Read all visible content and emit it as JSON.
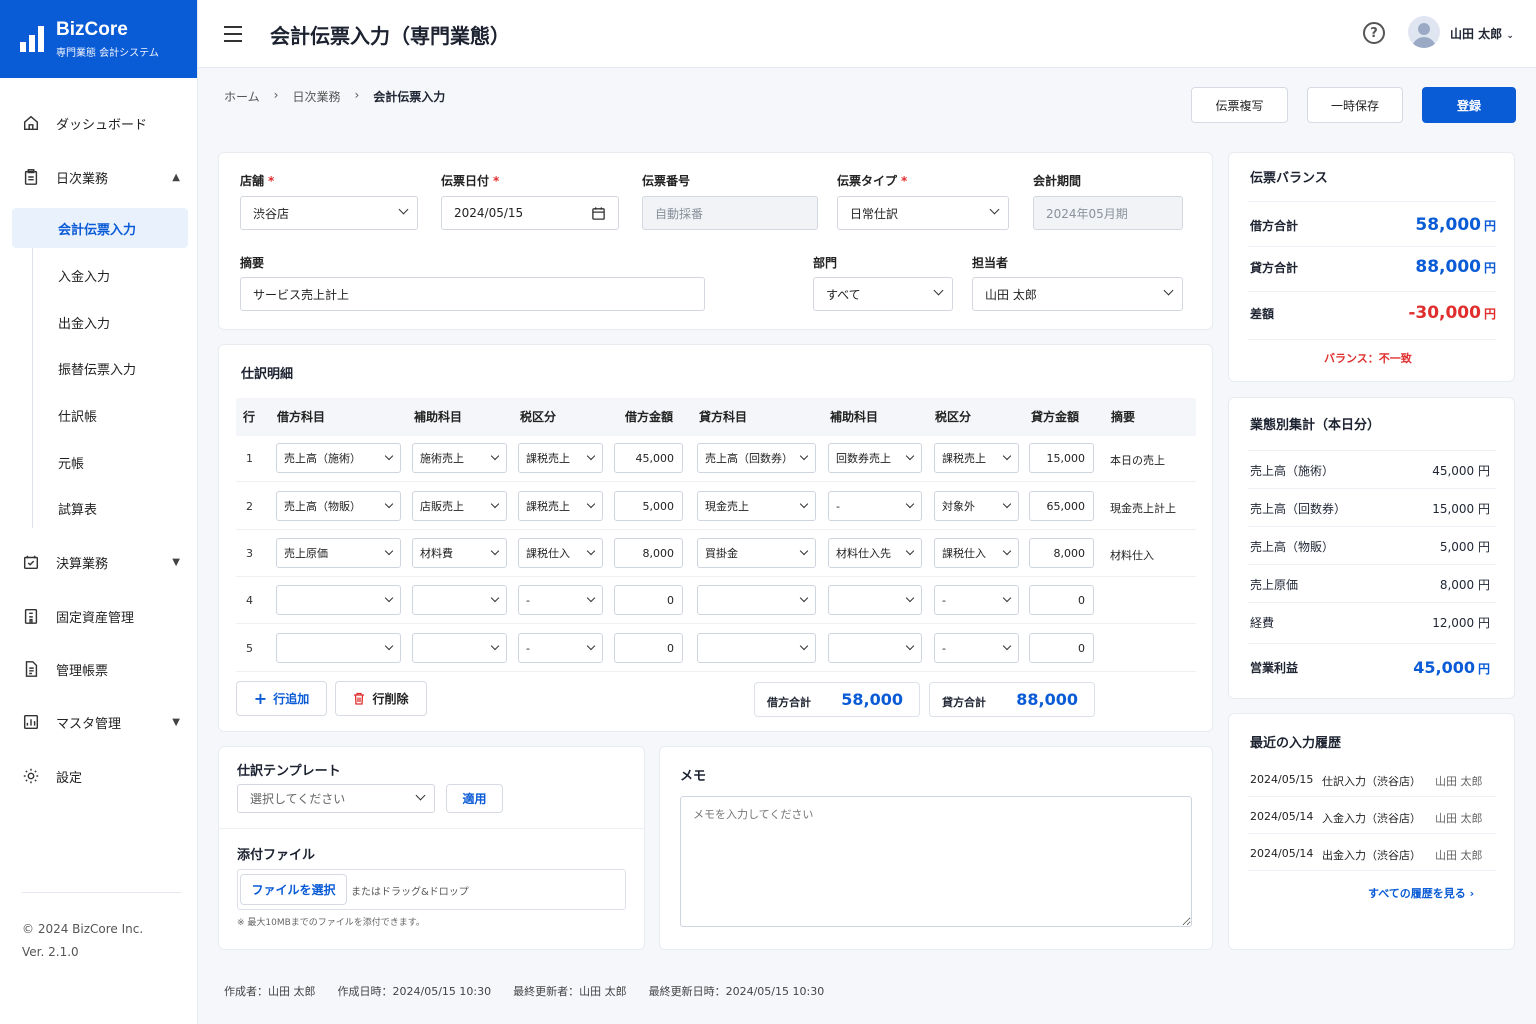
{
  "app": {
    "name": "BizCore",
    "subtitle": "専門業態 会計システム",
    "copyright": "© 2024 BizCore Inc.",
    "version": "Ver. 2.1.0"
  },
  "nav": {
    "dashboard": "ダッシュボード",
    "daily": "日次業務",
    "daily_items": [
      "会計伝票入力",
      "入金入力",
      "出金入力",
      "振替伝票入力",
      "仕訳帳",
      "元帳",
      "試算表"
    ],
    "closing": "決算業務",
    "fixed_assets": "固定資産管理",
    "reports": "管理帳票",
    "master": "マスタ管理",
    "settings": "設定"
  },
  "header": {
    "title": "会計伝票入力（専門業態）",
    "user": "山田 太郎"
  },
  "breadcrumb": [
    "ホーム",
    "日次業務",
    "会計伝票入力"
  ],
  "actions": {
    "copy": "伝票複写",
    "save_draft": "一時保存",
    "register": "登録"
  },
  "form": {
    "store_label": "店舗",
    "store": "渋谷店",
    "date_label": "伝票日付",
    "date": "2024/05/15",
    "no_label": "伝票番号",
    "no_placeholder": "自動採番",
    "type_label": "伝票タイプ",
    "type": "日常仕訳",
    "period_label": "会計期間",
    "period": "2024年05月期",
    "summary_label": "摘要",
    "summary": "サービス売上計上",
    "dept_label": "部門",
    "dept": "すべて",
    "person_label": "担当者",
    "person": "山田 太郎"
  },
  "journal": {
    "title": "仕訳明細",
    "headers": [
      "行",
      "借方科目",
      "補助科目",
      "税区分",
      "借方金額",
      "貸方科目",
      "補助科目",
      "税区分",
      "貸方金額",
      "摘要"
    ],
    "rows": [
      {
        "no": "1",
        "dr": "売上高（施術）",
        "dr_sub": "施術売上",
        "dr_tax": "課税売上",
        "dr_amt": "45,000",
        "cr": "売上高（回数券）",
        "cr_sub": "回数券売上",
        "cr_tax": "課税売上",
        "cr_amt": "15,000",
        "memo": "本日の売上"
      },
      {
        "no": "2",
        "dr": "売上高（物販）",
        "dr_sub": "店販売上",
        "dr_tax": "課税売上",
        "dr_amt": "5,000",
        "cr": "現金売上",
        "cr_sub": "-",
        "cr_tax": "対象外",
        "cr_amt": "65,000",
        "memo": "現金売上計上"
      },
      {
        "no": "3",
        "dr": "売上原価",
        "dr_sub": "材料費",
        "dr_tax": "課税仕入",
        "dr_amt": "8,000",
        "cr": "買掛金",
        "cr_sub": "材料仕入先",
        "cr_tax": "課税仕入",
        "cr_amt": "8,000",
        "memo": "材料仕入"
      },
      {
        "no": "4",
        "dr": "",
        "dr_sub": "",
        "dr_tax": "-",
        "dr_amt": "0",
        "cr": "",
        "cr_sub": "",
        "cr_tax": "-",
        "cr_amt": "0",
        "memo": ""
      },
      {
        "no": "5",
        "dr": "",
        "dr_sub": "",
        "dr_tax": "-",
        "dr_amt": "0",
        "cr": "",
        "cr_sub": "",
        "cr_tax": "-",
        "cr_amt": "0",
        "memo": ""
      }
    ],
    "add_row": "行追加",
    "del_row": "行削除",
    "dr_total_label": "借方合計",
    "dr_total": "58,000",
    "cr_total_label": "貸方合計",
    "cr_total": "88,000"
  },
  "template": {
    "title": "仕訳テンプレート",
    "placeholder": "選択してください",
    "apply": "適用"
  },
  "attach": {
    "title": "添付ファイル",
    "choose": "ファイルを選択",
    "drop": "またはドラッグ&ドロップ",
    "note": "※ 最大10MBまでのファイルを添付できます。"
  },
  "memo": {
    "title": "メモ",
    "placeholder": "メモを入力してください"
  },
  "balance": {
    "title": "伝票バランス",
    "dr_label": "借方合計",
    "dr": "58,000",
    "cr_label": "貸方合計",
    "cr": "88,000",
    "diff_label": "差額",
    "diff": "-30,000",
    "unit": "円",
    "status": "バランス：不一致",
    "accent": "#0a5bd6",
    "error": "#e02e2e"
  },
  "summary": {
    "title": "業態別集計（本日分）",
    "items": [
      {
        "k": "売上高（施術）",
        "v": "45,000 円"
      },
      {
        "k": "売上高（回数券）",
        "v": "15,000 円"
      },
      {
        "k": "売上高（物販）",
        "v": "5,000 円"
      },
      {
        "k": "売上原価",
        "v": "8,000 円"
      },
      {
        "k": "経費",
        "v": "12,000 円"
      }
    ],
    "profit_label": "営業利益",
    "profit": "45,000",
    "unit": "円"
  },
  "history": {
    "title": "最近の入力履歴",
    "items": [
      {
        "d": "2024/05/15",
        "t": "仕訳入力（渋谷店）",
        "u": "山田 太郎"
      },
      {
        "d": "2024/05/14",
        "t": "入金入力（渋谷店）",
        "u": "山田 太郎"
      },
      {
        "d": "2024/05/14",
        "t": "出金入力（渋谷店）",
        "u": "山田 太郎"
      }
    ],
    "all": "すべての履歴を見る"
  },
  "meta": {
    "creator": "作成者：山田 太郎",
    "created": "作成日時：2024/05/15 10:30",
    "updater": "最終更新者：山田 太郎",
    "updated": "最終更新日時：2024/05/15 10:30"
  }
}
